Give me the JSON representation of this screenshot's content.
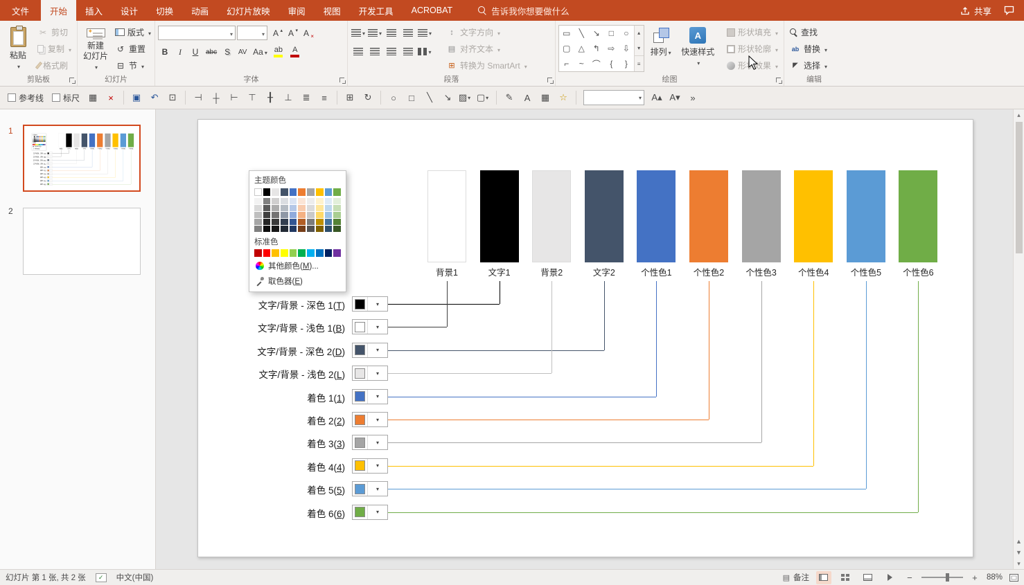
{
  "titlebar": {
    "tabs": [
      {
        "id": "file",
        "label": "文件",
        "active": false
      },
      {
        "id": "home",
        "label": "开始",
        "active": true
      },
      {
        "id": "insert",
        "label": "插入",
        "active": false
      },
      {
        "id": "design",
        "label": "设计",
        "active": false
      },
      {
        "id": "transitions",
        "label": "切换",
        "active": false
      },
      {
        "id": "animations",
        "label": "动画",
        "active": false
      },
      {
        "id": "slideshow",
        "label": "幻灯片放映",
        "active": false
      },
      {
        "id": "review",
        "label": "审阅",
        "active": false
      },
      {
        "id": "view",
        "label": "视图",
        "active": false
      },
      {
        "id": "developer",
        "label": "开发工具",
        "active": false
      },
      {
        "id": "acrobat",
        "label": "ACROBAT",
        "active": false
      }
    ],
    "search": "告诉我你想要做什么",
    "share": "共享"
  },
  "ribbon": {
    "clipboard": {
      "label": "剪贴板",
      "paste": "粘贴",
      "cut": "剪切",
      "copy": "复制",
      "painter": "格式刷"
    },
    "slides": {
      "label": "幻灯片",
      "new_slide_1": "新建",
      "new_slide_2": "幻灯片",
      "layout": "版式",
      "reset": "重置",
      "section": "节"
    },
    "font": {
      "label": "字体",
      "bold": "B",
      "italic": "I",
      "underline": "U",
      "strike": "abc",
      "shadow": "S",
      "spacing": "AV",
      "case": "Aa",
      "grow": "A",
      "shrink": "A",
      "clear": "A",
      "highlight": "ab",
      "color": "A"
    },
    "paragraph": {
      "label": "段落",
      "text_direction": "文字方向",
      "align_text": "对齐文本",
      "smartart": "转换为 SmartArt"
    },
    "drawing": {
      "label": "绘图",
      "arrange": "排列",
      "quick_styles": "快速样式",
      "shape_fill": "形状填充",
      "shape_outline": "形状轮廓",
      "shape_effects": "形状效果",
      "shapes": [
        "▭",
        "╲",
        "↘",
        "□",
        "○",
        "▢",
        "△",
        "↰",
        "⇨",
        "⇩",
        "⌐",
        "~",
        "⌒",
        "{",
        "}"
      ]
    },
    "editing": {
      "label": "编辑",
      "find": "查找",
      "replace": "替换",
      "select": "选择"
    }
  },
  "qat": {
    "items": [
      {
        "type": "check",
        "name": "guides-checkbox",
        "label": "参考线"
      },
      {
        "type": "check",
        "name": "ruler-checkbox",
        "label": "标尺"
      },
      {
        "name": "grid-settings",
        "glyph": "▦"
      },
      {
        "name": "close-presentation",
        "glyph": "×",
        "color": "#C00000"
      },
      {
        "type": "sep"
      },
      {
        "name": "save",
        "glyph": "▣",
        "color": "#2B579A"
      },
      {
        "name": "undo",
        "glyph": "↶",
        "color": "#2B579A"
      },
      {
        "name": "start-slideshow",
        "glyph": "⊡",
        "color": "#4A4A4A"
      },
      {
        "type": "sep"
      },
      {
        "name": "align-left",
        "glyph": "⊣"
      },
      {
        "name": "align-center",
        "glyph": "┼"
      },
      {
        "name": "align-right",
        "glyph": "⊢"
      },
      {
        "name": "align-top",
        "glyph": "⊤"
      },
      {
        "name": "align-middle",
        "glyph": "╂"
      },
      {
        "name": "align-bottom",
        "glyph": "⊥"
      },
      {
        "name": "distribute-horizontal",
        "glyph": "≣"
      },
      {
        "name": "distribute-vertical",
        "glyph": "≡"
      },
      {
        "type": "sep"
      },
      {
        "name": "group-objects",
        "glyph": "⊞"
      },
      {
        "name": "rotate-objects",
        "glyph": "↻"
      },
      {
        "type": "sep"
      },
      {
        "name": "shape-oval",
        "glyph": "○"
      },
      {
        "name": "shape-rectangle",
        "glyph": "□"
      },
      {
        "name": "shape-line",
        "glyph": "╲"
      },
      {
        "name": "shape-arrow",
        "glyph": "↘"
      },
      {
        "name": "shape-fill-color",
        "glyph": "▨",
        "caret": true
      },
      {
        "name": "shape-outline-color",
        "glyph": "▢",
        "caret": true
      },
      {
        "type": "sep"
      },
      {
        "name": "pencil-tool",
        "glyph": "✎"
      },
      {
        "name": "text-box",
        "glyph": "A"
      },
      {
        "name": "insert-table",
        "glyph": "▦"
      },
      {
        "name": "highlight-tool",
        "glyph": "☆",
        "color": "#C99700"
      },
      {
        "type": "sep"
      },
      {
        "type": "combo",
        "name": "style-combobox"
      },
      {
        "name": "grow-font",
        "glyph": "A▴"
      },
      {
        "name": "shrink-font",
        "glyph": "A▾"
      },
      {
        "name": "more-commands",
        "glyph": "»"
      }
    ]
  },
  "panel": {
    "slide1": "1",
    "slide2": "2"
  },
  "popup": {
    "title": "主题颜色",
    "standard_label": "标准色",
    "more_colors": "其他颜色(M)...",
    "eyedropper": "取色器(E)",
    "theme_colors": [
      "#FFFFFF",
      "#000000",
      "#E7E6E6",
      "#44546A",
      "#4472C4",
      "#ED7D31",
      "#A5A5A5",
      "#FFC000",
      "#5B9BD5",
      "#70AD47"
    ],
    "standard_colors": [
      "#C00000",
      "#FF0000",
      "#FFC000",
      "#FFFF00",
      "#92D050",
      "#00B050",
      "#00B0F0",
      "#0070C0",
      "#002060",
      "#7030A0"
    ]
  },
  "diagram": {
    "bars": [
      {
        "label": "背景1",
        "color": "#FFFFFF"
      },
      {
        "label": "文字1",
        "color": "#000000"
      },
      {
        "label": "背景2",
        "color": "#E7E6E6"
      },
      {
        "label": "文字2",
        "color": "#44546A"
      },
      {
        "label": "个性色1",
        "color": "#4472C4"
      },
      {
        "label": "个性色2",
        "color": "#ED7D31"
      },
      {
        "label": "个性色3",
        "color": "#A5A5A5"
      },
      {
        "label": "个性色4",
        "color": "#FFC000"
      },
      {
        "label": "个性色5",
        "color": "#5B9BD5"
      },
      {
        "label": "个性色6",
        "color": "#70AD47"
      }
    ],
    "rows": [
      {
        "label": "文字/背景 - 深色 1(T)",
        "color": "#000000",
        "target": 1,
        "line": "#000000"
      },
      {
        "label": "文字/背景 - 浅色 1(B)",
        "color": "#FFFFFF",
        "target": 0,
        "line": "#3F3F3F"
      },
      {
        "label": "文字/背景 - 深色 2(D)",
        "color": "#44546A",
        "target": 3,
        "line": "#44546A"
      },
      {
        "label": "文字/背景 - 浅色 2(L)",
        "color": "#E7E6E6",
        "target": 2,
        "line": "#BFBFBF"
      },
      {
        "label": "着色 1(1)",
        "color": "#4472C4",
        "target": 4,
        "line": "#4472C4"
      },
      {
        "label": "着色 2(2)",
        "color": "#ED7D31",
        "target": 5,
        "line": "#ED7D31"
      },
      {
        "label": "着色 3(3)",
        "color": "#A5A5A5",
        "target": 6,
        "line": "#A5A5A5"
      },
      {
        "label": "着色 4(4)",
        "color": "#FFC000",
        "target": 7,
        "line": "#FFC000"
      },
      {
        "label": "着色 5(5)",
        "color": "#5B9BD5",
        "target": 8,
        "line": "#5B9BD5"
      },
      {
        "label": "着色 6(6)",
        "color": "#70AD47",
        "target": 9,
        "line": "#70AD47"
      }
    ]
  },
  "statusbar": {
    "slide_info": "幻灯片 第 1 张, 共 2 张",
    "language": "中文(中国)",
    "notes": "备注",
    "zoom": "88%"
  }
}
